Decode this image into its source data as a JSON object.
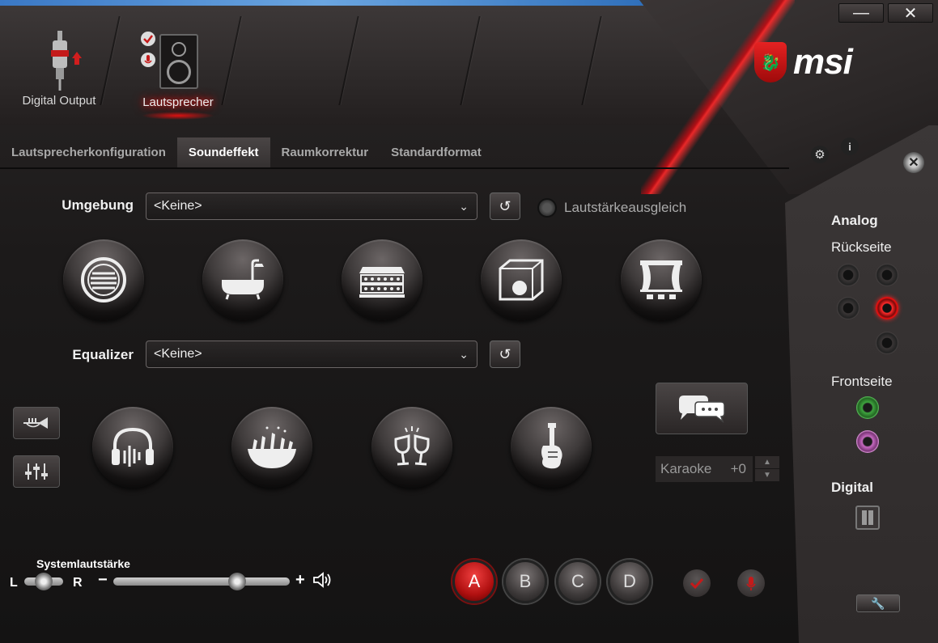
{
  "window": {
    "minimize_label": "—",
    "close_label": "✕"
  },
  "brand": {
    "logo_text": "msi"
  },
  "devices": [
    {
      "label": "Digital Output",
      "active": false
    },
    {
      "label": "Lautsprecher",
      "active": true
    }
  ],
  "tabs": [
    {
      "label": "Lautsprecherkonfiguration",
      "active": false
    },
    {
      "label": "Soundeffekt",
      "active": true
    },
    {
      "label": "Raumkorrektur",
      "active": false
    },
    {
      "label": "Standardformat",
      "active": false
    }
  ],
  "environment": {
    "label": "Umgebung",
    "selected": "<Keine>",
    "loudness_label": "Lautstärkeausgleich",
    "presets": [
      "padded-cell-icon",
      "bathroom-icon",
      "stadium-icon",
      "room-icon",
      "theater-icon"
    ]
  },
  "equalizer": {
    "label": "Equalizer",
    "selected": "<Keine>",
    "presets": [
      "headphones-icon",
      "live-crowd-icon",
      "toast-glasses-icon",
      "guitar-icon"
    ]
  },
  "karaoke": {
    "label": "Karaoke",
    "value": "+0"
  },
  "volume": {
    "label": "Systemlautstärke",
    "left_label": "L",
    "right_label": "R",
    "minus_label": "−",
    "plus_label": "+",
    "level": 0.7
  },
  "profiles": [
    {
      "label": "A",
      "active": true
    },
    {
      "label": "B",
      "active": false
    },
    {
      "label": "C",
      "active": false
    },
    {
      "label": "D",
      "active": false
    }
  ],
  "panel": {
    "analog_label": "Analog",
    "rear_label": "Rückseite",
    "front_label": "Frontseite",
    "digital_label": "Digital"
  },
  "colors": {
    "accent": "#e01b22",
    "jack_green": "#3fa43f",
    "jack_pink": "#c56ac0"
  }
}
